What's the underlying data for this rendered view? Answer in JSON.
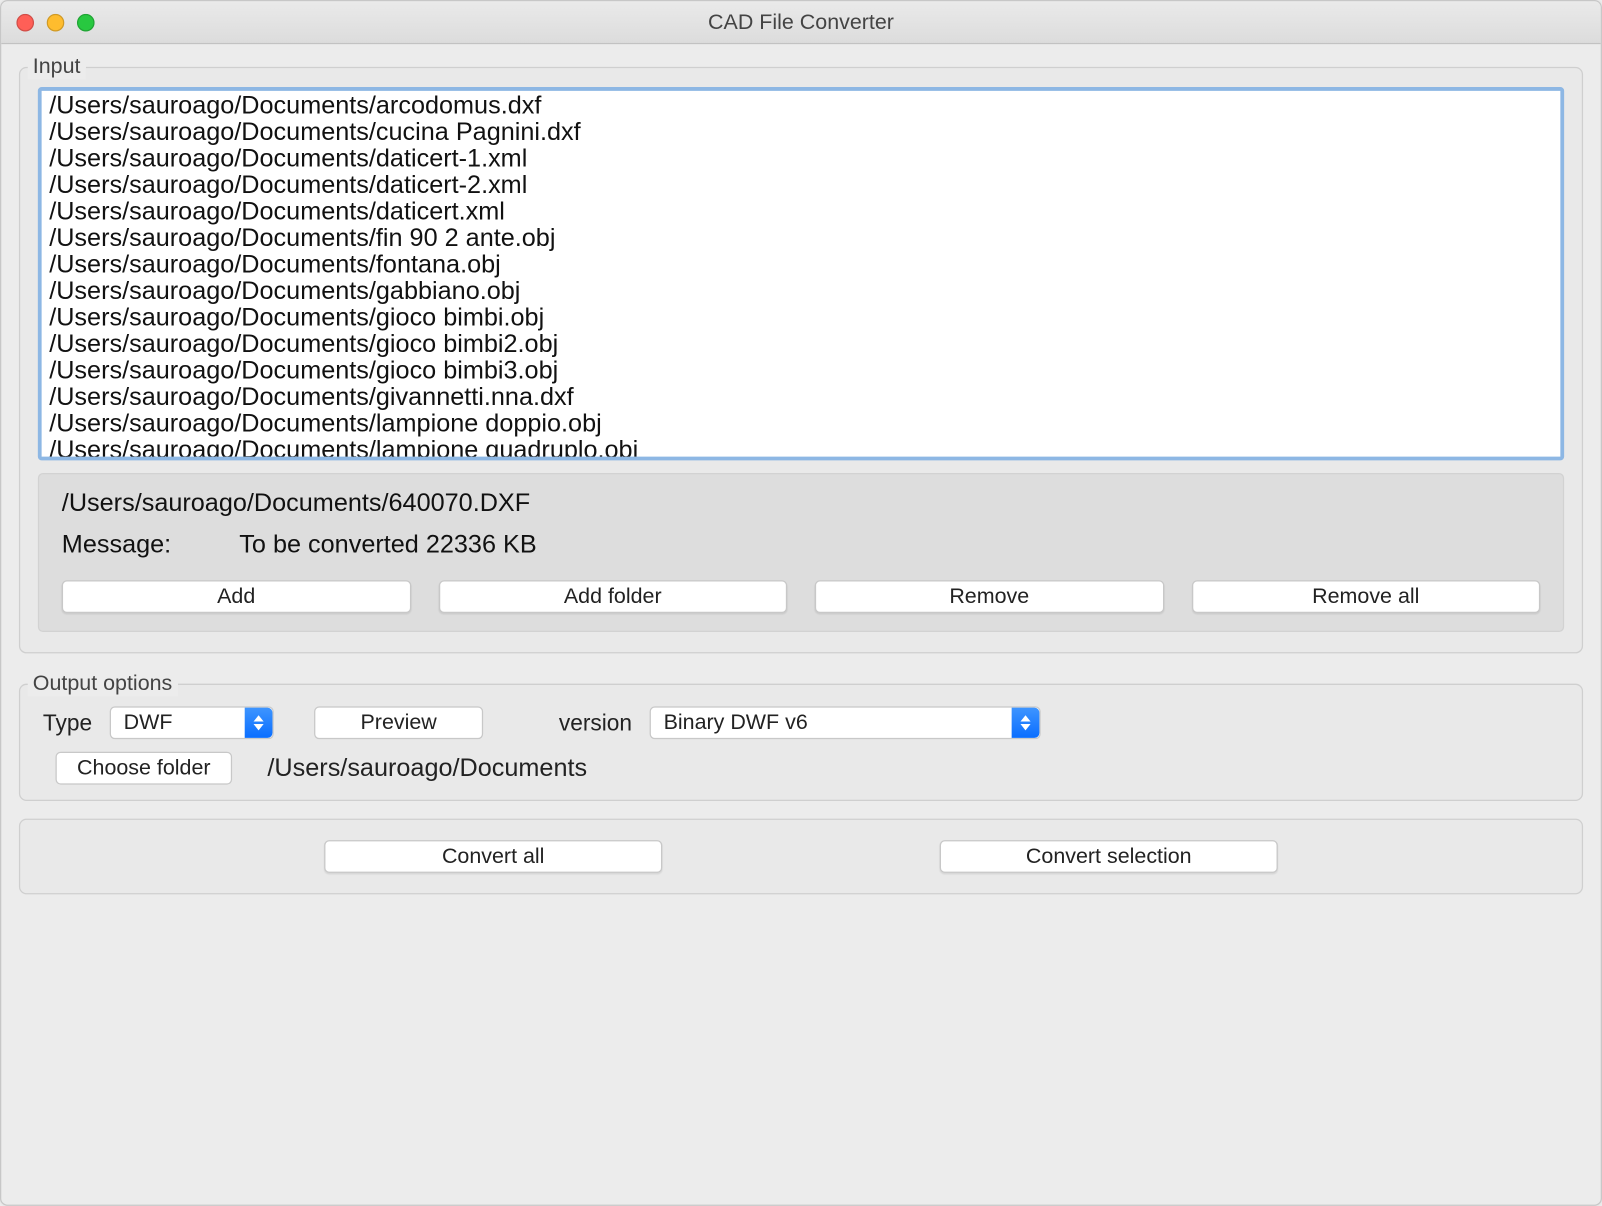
{
  "window": {
    "title": "CAD File Converter"
  },
  "input": {
    "legend": "Input",
    "files": [
      "/Users/sauroago/Documents/arcodomus.dxf",
      "/Users/sauroago/Documents/cucina Pagnini.dxf",
      "/Users/sauroago/Documents/daticert-1.xml",
      "/Users/sauroago/Documents/daticert-2.xml",
      "/Users/sauroago/Documents/daticert.xml",
      "/Users/sauroago/Documents/fin 90 2 ante.obj",
      "/Users/sauroago/Documents/fontana.obj",
      "/Users/sauroago/Documents/gabbiano.obj",
      "/Users/sauroago/Documents/gioco bimbi.obj",
      "/Users/sauroago/Documents/gioco bimbi2.obj",
      "/Users/sauroago/Documents/gioco bimbi3.obj",
      "/Users/sauroago/Documents/givannetti.nna.dxf",
      "/Users/sauroago/Documents/lampione doppio.obj",
      "/Users/sauroago/Documents/lampione quadruplo.obj"
    ],
    "selected_file": "/Users/sauroago/Documents/640070.DXF",
    "message_label": "Message:",
    "message_value": "To be converted 22336 KB",
    "buttons": {
      "add": "Add",
      "add_folder": "Add folder",
      "remove": "Remove",
      "remove_all": "Remove all"
    }
  },
  "output": {
    "legend": "Output options",
    "type_label": "Type",
    "type_value": "DWF",
    "preview_label": "Preview",
    "version_label": "version",
    "version_value": "Binary DWF v6",
    "choose_folder_label": "Choose folder",
    "folder_path": "/Users/sauroago/Documents"
  },
  "actions": {
    "convert_all": "Convert all",
    "convert_selection": "Convert selection"
  }
}
